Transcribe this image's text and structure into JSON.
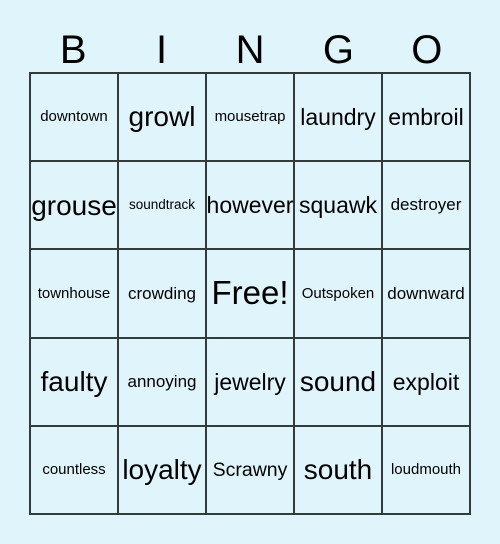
{
  "card": {
    "title_letters": [
      "B",
      "I",
      "N",
      "G",
      "O"
    ],
    "background_color": "#e0f4fb",
    "border_color": "#333b3d",
    "text_color": "#000000",
    "columns": 5,
    "rows": 5,
    "free_space": {
      "label": "Free!",
      "row": 3,
      "column": 3
    },
    "rows_data": [
      {
        "cells": [
          {
            "label": "downtown",
            "size": "s-sm"
          },
          {
            "label": "growl",
            "size": "s-xxl"
          },
          {
            "label": "mousetrap",
            "size": "s-sm"
          },
          {
            "label": "laundry",
            "size": "s-xl"
          },
          {
            "label": "embroil",
            "size": "s-xl"
          }
        ]
      },
      {
        "cells": [
          {
            "label": "grouse",
            "size": "s-xxl"
          },
          {
            "label": "soundtrack",
            "size": "s-xs"
          },
          {
            "label": "however",
            "size": "s-xl"
          },
          {
            "label": "squawk",
            "size": "s-xl"
          },
          {
            "label": "destroyer",
            "size": "s-md"
          }
        ]
      },
      {
        "cells": [
          {
            "label": "townhouse",
            "size": "s-sm"
          },
          {
            "label": "crowding",
            "size": "s-md"
          },
          {
            "label": "Free!",
            "size": "s-free"
          },
          {
            "label": "Outspoken",
            "size": "s-sm"
          },
          {
            "label": "downward",
            "size": "s-md"
          }
        ]
      },
      {
        "cells": [
          {
            "label": "faulty",
            "size": "s-xxl"
          },
          {
            "label": "annoying",
            "size": "s-md"
          },
          {
            "label": "jewelry",
            "size": "s-xl"
          },
          {
            "label": "sound",
            "size": "s-xxl"
          },
          {
            "label": "exploit",
            "size": "s-xl"
          }
        ]
      },
      {
        "cells": [
          {
            "label": "countless",
            "size": "s-sm"
          },
          {
            "label": "loyalty",
            "size": "s-xxl"
          },
          {
            "label": "Scrawny",
            "size": "s-lg"
          },
          {
            "label": "south",
            "size": "s-xxl"
          },
          {
            "label": "loudmouth",
            "size": "s-sm"
          }
        ]
      }
    ]
  }
}
